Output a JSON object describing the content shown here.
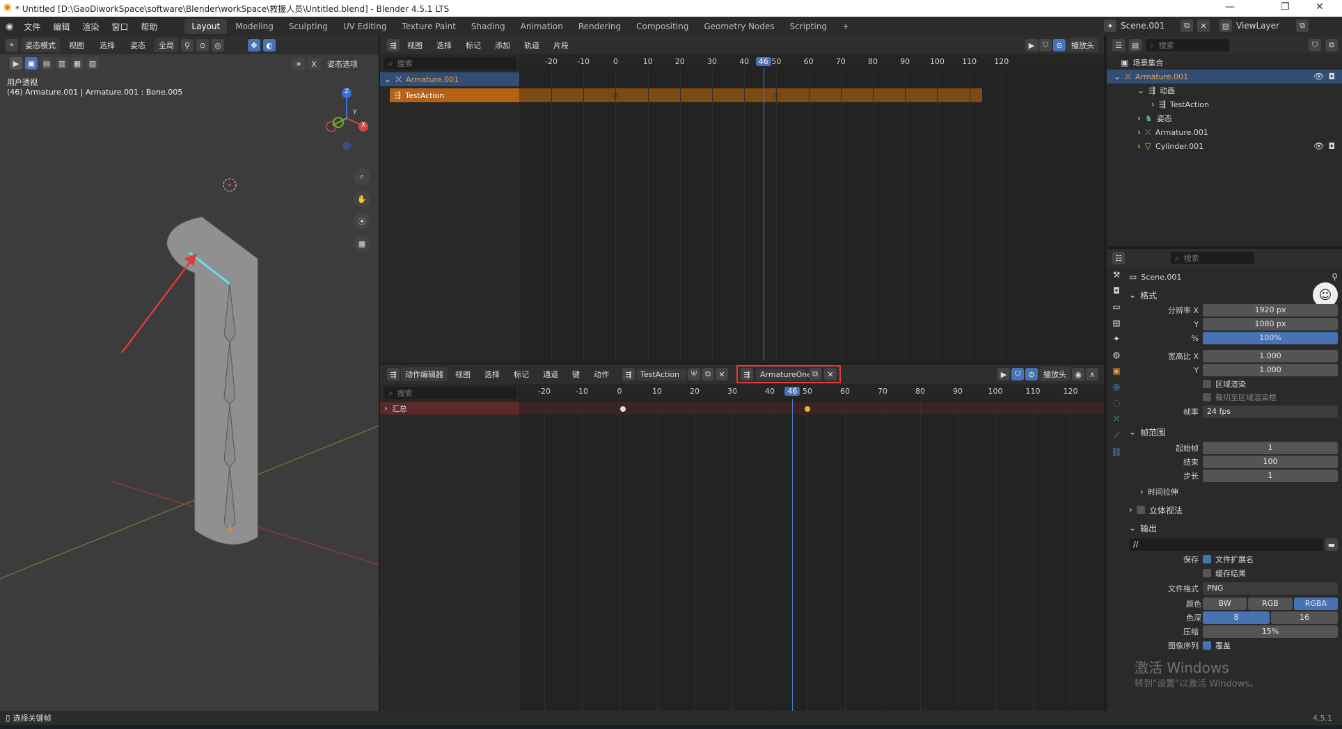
{
  "window": {
    "title": "* Untitled [D:\\GaoDiworkSpace\\software\\Blender\\workSpace\\救援人员\\Untitled.blend] - Blender 4.5.1 LTS",
    "minimize": "—",
    "maximize": "❐",
    "close": "✕"
  },
  "menu": [
    "文件",
    "编辑",
    "渲染",
    "窗口",
    "帮助"
  ],
  "workspaces": [
    "Layout",
    "Modeling",
    "Sculpting",
    "UV Editing",
    "Texture Paint",
    "Shading",
    "Animation",
    "Rendering",
    "Compositing",
    "Geometry Nodes",
    "Scripting"
  ],
  "workspace_add": "+",
  "scene": {
    "name": "Scene.001",
    "viewlayer": "ViewLayer"
  },
  "viewport": {
    "mode": "姿态模式",
    "menus": [
      "视图",
      "选择",
      "姿态"
    ],
    "transform": "全局",
    "pose_options": "姿态选项",
    "overlay_title": "用户透视",
    "overlay_info": "(46) Armature.001 | Armature.001 : Bone.005",
    "axis_x": "X",
    "axis_y": "Y",
    "axis_z": "Z"
  },
  "nla": {
    "menus": [
      "视图",
      "选择",
      "标记",
      "添加",
      "轨道",
      "片段"
    ],
    "playhead_label": "播放头",
    "search_placeholder": "搜索",
    "ticks": [
      "-20",
      "-10",
      "0",
      "10",
      "20",
      "30",
      "40",
      "50",
      "60",
      "70",
      "80",
      "90",
      "100",
      "110",
      "120"
    ],
    "current_frame": "46",
    "track_armature": "Armature.001",
    "track_action": "TestAction"
  },
  "dopesheet": {
    "editor_type": "动作编辑器",
    "menus": [
      "视图",
      "选择",
      "标记",
      "通道",
      "键",
      "动作"
    ],
    "action": "TestAction",
    "slot": "ArmatureOne",
    "playhead_label": "播放头",
    "search_placeholder": "搜索",
    "ticks": [
      "-20",
      "-10",
      "0",
      "10",
      "20",
      "30",
      "40",
      "50",
      "60",
      "70",
      "80",
      "90",
      "100",
      "110",
      "120"
    ],
    "current_frame": "46",
    "summary": "汇总"
  },
  "outliner": {
    "search_placeholder": "搜索",
    "items": [
      {
        "label": "场景集合",
        "indent": 0
      },
      {
        "label": "Armature.001",
        "indent": 1
      },
      {
        "label": "动画",
        "indent": 2
      },
      {
        "label": "TestAction",
        "indent": 3
      },
      {
        "label": "姿态",
        "indent": 2
      },
      {
        "label": "Armature.001",
        "indent": 2
      },
      {
        "label": "Cylinder.001",
        "indent": 2
      }
    ]
  },
  "properties": {
    "search_placeholder": "搜索",
    "scene_name": "Scene.001",
    "format_section": "格式",
    "res_x_label": "分辨率 X",
    "res_x": "1920 px",
    "res_y_label": "Y",
    "res_y": "1080 px",
    "res_pct_label": "%",
    "res_pct": "100%",
    "aspect_x_label": "宽高比 X",
    "aspect_x": "1.000",
    "aspect_y_label": "Y",
    "aspect_y": "1.000",
    "region_render": "区域渲染",
    "crop_region": "裁切至区域渲染框",
    "fps_label": "帧率",
    "fps": "24 fps",
    "frame_range_section": "帧范围",
    "frame_start_label": "起始帧",
    "frame_start": "1",
    "frame_end_label": "结束",
    "frame_end": "100",
    "frame_step_label": "步长",
    "frame_step": "1",
    "time_stretch": "时间拉伸",
    "stereoscopy": "立体视法",
    "output_section": "输出",
    "output_path": "//",
    "save_label": "保存",
    "file_ext": "文件扩展名",
    "cache_result": "缓存结果",
    "file_format_label": "文件格式",
    "file_format": "PNG",
    "color_label": "颜色",
    "color_bw": "BW",
    "color_rgb": "RGB",
    "color_rgba": "RGBA",
    "depth_label": "色深",
    "depth_8": "8",
    "depth_16": "16",
    "compression_label": "压缩",
    "compression": "15%",
    "image_seq_label": "图像序列",
    "overwrite": "覆盖"
  },
  "watermark": {
    "line1": "激活 Windows",
    "line2": "转到\"设置\"以激活 Windows。"
  },
  "status": {
    "left": "选择关键帧",
    "version": "4.5.1"
  },
  "colors": {
    "accent": "#4772b3",
    "highlight_red": "#e03a3a",
    "nla_strip": "#c06a1a",
    "header": "#2b2b2b"
  }
}
